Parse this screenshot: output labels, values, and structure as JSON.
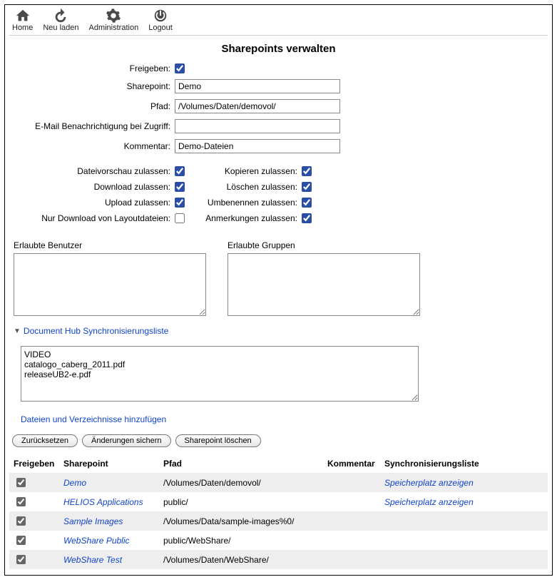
{
  "toolbar": {
    "home": "Home",
    "reload": "Neu laden",
    "admin": "Administration",
    "logout": "Logout"
  },
  "page_title": "Sharepoints verwalten",
  "labels": {
    "freigeben": "Freigeben:",
    "sharepoint": "Sharepoint:",
    "pfad": "Pfad:",
    "email": "E-Mail Benachrichtigung bei Zugriff:",
    "kommentar": "Kommentar:",
    "dateivorschau": "Dateivorschau zulassen:",
    "download": "Download zulassen:",
    "upload": "Upload zulassen:",
    "layout": "Nur Download von Layoutdateien:",
    "kopieren": "Kopieren zulassen:",
    "loeschen": "Löschen zulassen:",
    "umbenennen": "Umbenennen zulassen:",
    "anmerkungen": "Anmerkungen zulassen:",
    "benutzer": "Erlaubte Benutzer",
    "gruppen": "Erlaubte Gruppen",
    "sync_list": "Document Hub Synchronisierungsliste",
    "add_files": "Dateien und Verzeichnisse hinzufügen"
  },
  "values": {
    "sharepoint": "Demo",
    "pfad": "/Volumes/Daten/demovol/",
    "email": "",
    "kommentar": "Demo-Dateien",
    "sync_text": "VIDEO\ncatalogo_caberg_2011.pdf\nreleaseUB2-e.pdf"
  },
  "buttons": {
    "reset": "Zurücksetzen",
    "save": "Änderungen sichern",
    "delete": "Sharepoint löschen"
  },
  "table": {
    "headers": {
      "freigeben": "Freigeben",
      "sharepoint": "Sharepoint",
      "pfad": "Pfad",
      "kommentar": "Kommentar",
      "sync": "Synchronisierungsliste"
    },
    "rows": [
      {
        "checked": true,
        "sharepoint": "Demo",
        "pfad": "/Volumes/Daten/demovol/",
        "kommentar": "",
        "sync": "Speicherplatz anzeigen"
      },
      {
        "checked": true,
        "sharepoint": "HELIOS Applications",
        "pfad": "public/",
        "kommentar": "",
        "sync": "Speicherplatz anzeigen"
      },
      {
        "checked": true,
        "sharepoint": "Sample Images",
        "pfad": "/Volumes/Data/sample-images%0/",
        "kommentar": "",
        "sync": ""
      },
      {
        "checked": true,
        "sharepoint": "WebShare Public",
        "pfad": "public/WebShare/",
        "kommentar": "",
        "sync": ""
      },
      {
        "checked": true,
        "sharepoint": "WebShare Test",
        "pfad": "/Volumes/Daten/WebShare/",
        "kommentar": "",
        "sync": ""
      }
    ]
  }
}
